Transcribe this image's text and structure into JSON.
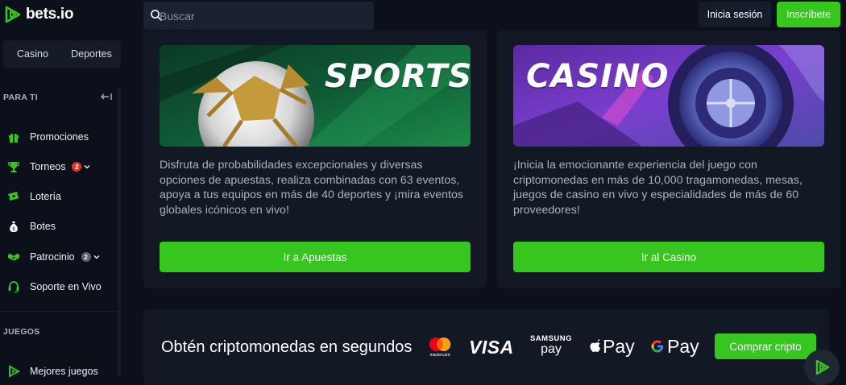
{
  "brand": {
    "name": "bets.io",
    "accent": "#37c51f"
  },
  "search": {
    "placeholder": "Buscar"
  },
  "header": {
    "login_label": "Inicia sesión",
    "register_label": "Inscríbete"
  },
  "sidebar": {
    "tabs": [
      "Casino",
      "Deportes"
    ],
    "section_for_you": "PARA TI",
    "items": [
      {
        "label": "Promociones",
        "icon": "gift-icon"
      },
      {
        "label": "Torneos",
        "icon": "trophy-icon",
        "badge": "2",
        "badge_color": "#e0352b"
      },
      {
        "label": "Lotería",
        "icon": "ticket-icon"
      },
      {
        "label": "Botes",
        "icon": "money-bag-icon"
      },
      {
        "label": "Patrocinio",
        "icon": "handshake-icon",
        "badge": "2",
        "badge_color": "#5a6275"
      },
      {
        "label": "Soporte en Vivo",
        "icon": "headset-icon"
      }
    ],
    "section_games": "JUEGOS",
    "games_items": [
      {
        "label": "Mejores juegos",
        "icon": "logo-icon"
      }
    ]
  },
  "cards": [
    {
      "image_title": "SPORTS",
      "description": "Disfruta de probabilidades excepcionales y diversas opciones de apuestas, realiza combinadas con 63 eventos, apoya a tus equipos en más de 40 deportes y ¡mira eventos globales icónicos en vivo!",
      "button_label": "Ir a Apuestas"
    },
    {
      "image_title": "CASINO",
      "description": "¡Inicia la emocionante experiencia del juego con criptomonedas en más de 10,000 tragamonedas, mesas, juegos de casino en vivo y especialidades de más de 60 proveedores!",
      "button_label": "Ir al Casino"
    }
  ],
  "crypto": {
    "title": "Obtén criptomonedas en segundos",
    "payment_methods": [
      "mastercard",
      "VISA",
      "SAMSUNG pay",
      "Apple Pay",
      "G Pay"
    ],
    "mastercard_label": "mastercard",
    "visa_label": "VISA",
    "samsung_top": "SAMSUNG",
    "samsung_bottom": "pay",
    "apple_label": "Pay",
    "google_label": "Pay",
    "button_label": "Comprar cripto"
  }
}
